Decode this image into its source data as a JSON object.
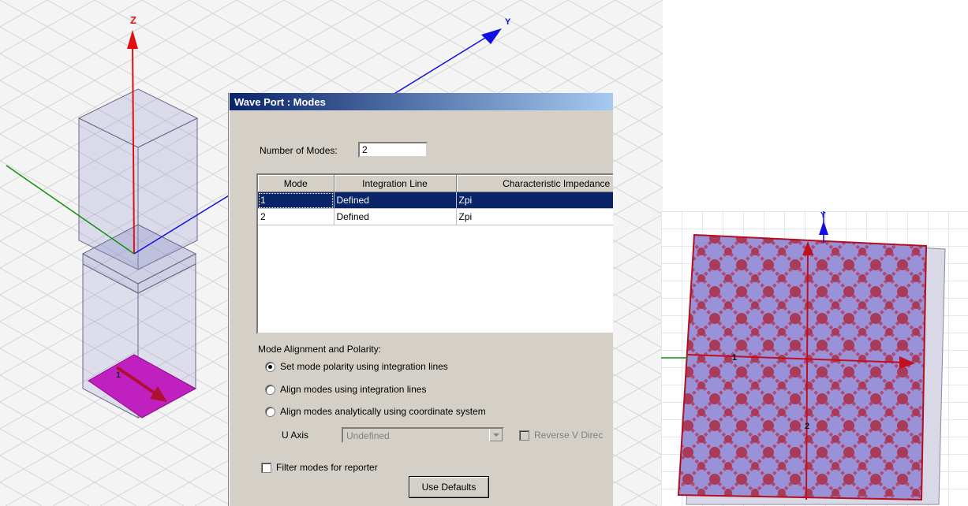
{
  "left_view": {
    "axis_z": "Z",
    "axis_y": "Y",
    "port_number": "1"
  },
  "dialog": {
    "title": "Wave Port : Modes",
    "modes_label": "Number of Modes:",
    "modes_value": "2",
    "table": {
      "headers": [
        "Mode",
        "Integration Line",
        "Characteristic Impedance (Z"
      ],
      "rows": [
        {
          "mode": "1",
          "integration_line": "Defined",
          "impedance": "Zpi",
          "selected": true
        },
        {
          "mode": "2",
          "integration_line": "Defined",
          "impedance": "Zpi",
          "selected": false
        }
      ]
    },
    "alignment_label": "Mode Alignment and Polarity:",
    "radio_polarity": "Set mode polarity using integration lines",
    "radio_align": "Align modes using integration lines",
    "radio_analytic": "Align modes analytically using coordinate system",
    "u_axis_label": "U Axis",
    "u_axis_value": "Undefined",
    "reverse_label": "Reverse V Direc",
    "filter_label": "Filter modes for reporter",
    "defaults_button": "Use Defaults"
  },
  "right_view": {
    "axis_y": "Y",
    "line1_label": "1",
    "line2_label": "2"
  },
  "colors": {
    "selection": "#0a246a",
    "dialog_face": "#d4d0c8",
    "port_magenta": "#c020c0",
    "axis_red": "#e01010",
    "axis_blue": "#1010e0",
    "axis_green": "#109010"
  }
}
